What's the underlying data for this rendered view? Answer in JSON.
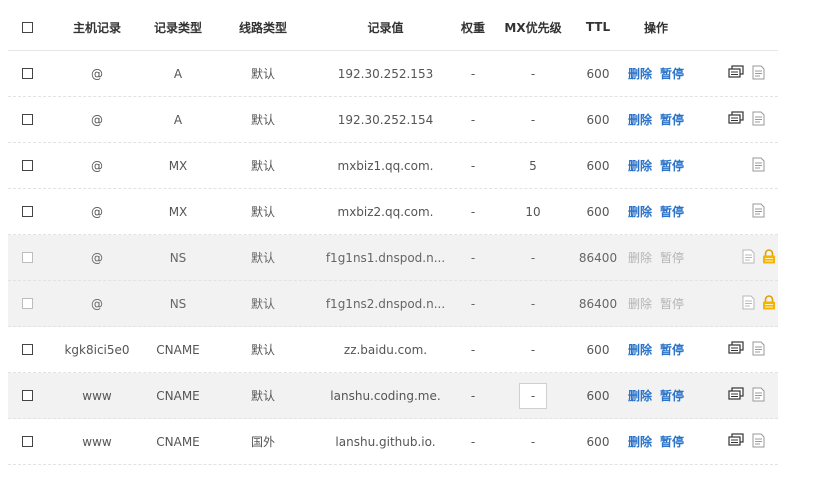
{
  "header": {
    "host": "主机记录",
    "type": "记录类型",
    "line": "线路类型",
    "value": "记录值",
    "weight": "权重",
    "mx": "MX优先级",
    "ttl": "TTL",
    "ops": "操作"
  },
  "records": [
    {
      "host": "@",
      "type": "A",
      "line": "默认",
      "value": "192.30.252.153",
      "weight": "-",
      "mx": "-",
      "ttl": "600",
      "delete": "删除",
      "pause": "暂停",
      "remark_icon": "comment-icon",
      "note_icon": "note-icon",
      "state": "normal"
    },
    {
      "host": "@",
      "type": "A",
      "line": "默认",
      "value": "192.30.252.154",
      "weight": "-",
      "mx": "-",
      "ttl": "600",
      "delete": "删除",
      "pause": "暂停",
      "remark_icon": "comment-icon",
      "note_icon": "note-icon",
      "state": "normal"
    },
    {
      "host": "@",
      "type": "MX",
      "line": "默认",
      "value": "mxbiz1.qq.com.",
      "weight": "-",
      "mx": "5",
      "ttl": "600",
      "delete": "删除",
      "pause": "暂停",
      "remark_icon": "",
      "note_icon": "note-icon",
      "state": "normal"
    },
    {
      "host": "@",
      "type": "MX",
      "line": "默认",
      "value": "mxbiz2.qq.com.",
      "weight": "-",
      "mx": "10",
      "ttl": "600",
      "delete": "删除",
      "pause": "暂停",
      "remark_icon": "",
      "note_icon": "note-icon",
      "state": "normal"
    },
    {
      "host": "@",
      "type": "NS",
      "line": "默认",
      "value": "f1g1ns1.dnspod.n...",
      "weight": "-",
      "mx": "-",
      "ttl": "86400",
      "delete": "删除",
      "pause": "暂停",
      "remark_icon": "",
      "note_icon": "note-icon",
      "lock_icon": "lock-icon",
      "state": "disabled"
    },
    {
      "host": "@",
      "type": "NS",
      "line": "默认",
      "value": "f1g1ns2.dnspod.n...",
      "weight": "-",
      "mx": "-",
      "ttl": "86400",
      "delete": "删除",
      "pause": "暂停",
      "remark_icon": "",
      "note_icon": "note-icon",
      "lock_icon": "lock-icon",
      "state": "disabled"
    },
    {
      "host": "kgk8ici5e0",
      "type": "CNAME",
      "line": "默认",
      "value": "zz.baidu.com.",
      "weight": "-",
      "mx": "-",
      "ttl": "600",
      "delete": "删除",
      "pause": "暂停",
      "remark_icon": "comment-icon",
      "note_icon": "note-icon",
      "state": "normal"
    },
    {
      "host": "www",
      "type": "CNAME",
      "line": "默认",
      "value": "lanshu.coding.me.",
      "weight": "-",
      "mx": "-",
      "ttl": "600",
      "delete": "删除",
      "pause": "暂停",
      "remark_icon": "comment-icon",
      "note_icon": "note-icon",
      "state": "hover",
      "mx_editing": true
    },
    {
      "host": "www",
      "type": "CNAME",
      "line": "国外",
      "value": "lanshu.github.io.",
      "weight": "-",
      "mx": "-",
      "ttl": "600",
      "delete": "删除",
      "pause": "暂停",
      "remark_icon": "comment-icon",
      "note_icon": "note-icon",
      "state": "normal"
    }
  ],
  "colors": {
    "link": "#2a73c9",
    "disabled_row": "#f2f2f2",
    "lock": "#f5b400"
  }
}
